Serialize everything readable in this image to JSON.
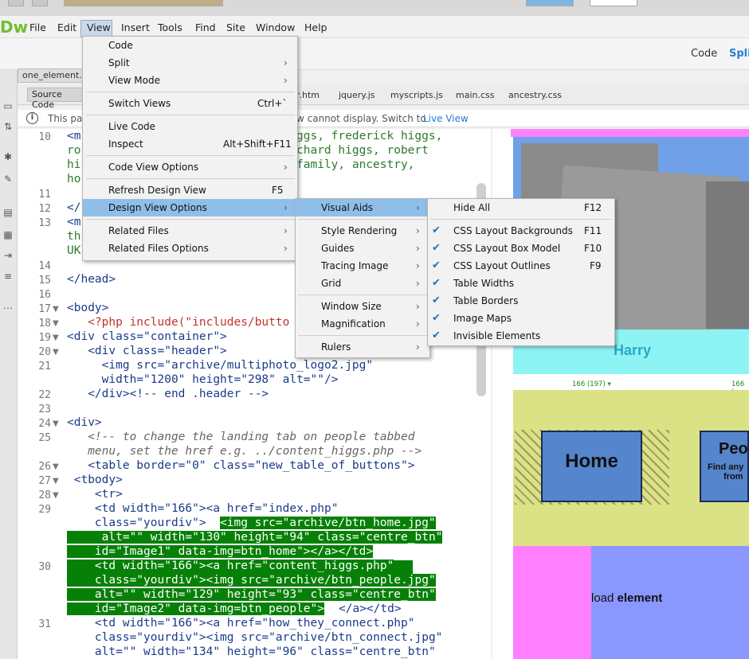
{
  "app": {
    "logo": "Dw"
  },
  "menubar": [
    "File",
    "Edit",
    "View",
    "Insert",
    "Tools",
    "Find",
    "Site",
    "Window",
    "Help"
  ],
  "viewmodes": {
    "code": "Code",
    "split": "Split"
  },
  "doc_tab": "one_element.h",
  "source_code_button": "Source Code",
  "file_tabs": [
    "r.htm",
    "jquery.js",
    "myscripts.js",
    "main.css",
    "ancestry.css"
  ],
  "infobar": {
    "pre": "This pag",
    "post": "w cannot display. Switch to",
    "link": "Live View",
    "end": "."
  },
  "view_menu": [
    {
      "label": "Code",
      "shortcut": "",
      "submenu": false
    },
    {
      "label": "Split",
      "shortcut": "",
      "submenu": true
    },
    {
      "label": "View Mode",
      "shortcut": "",
      "submenu": true
    },
    {
      "label": "Switch Views",
      "shortcut": "Ctrl+`",
      "submenu": false
    },
    {
      "label": "Live Code",
      "shortcut": "",
      "submenu": false
    },
    {
      "label": "Inspect",
      "shortcut": "Alt+Shift+F11",
      "submenu": false
    },
    {
      "label": "Code View Options",
      "shortcut": "",
      "submenu": true
    },
    {
      "label": "Refresh Design View",
      "shortcut": "F5",
      "submenu": false
    },
    {
      "label": "Design View Options",
      "shortcut": "",
      "submenu": true
    },
    {
      "label": "Related Files",
      "shortcut": "",
      "submenu": true
    },
    {
      "label": "Related Files Options",
      "shortcut": "",
      "submenu": true
    }
  ],
  "design_view_options_menu": [
    "Visual Aids",
    "Style Rendering",
    "Guides",
    "Tracing Image",
    "Grid",
    "Window Size",
    "Magnification",
    "Rulers"
  ],
  "visual_aids_menu": [
    {
      "label": "Hide All",
      "shortcut": "F12",
      "checked": false
    },
    {
      "label": "CSS Layout Backgrounds",
      "shortcut": "F11",
      "checked": true
    },
    {
      "label": "CSS Layout Box Model",
      "shortcut": "F10",
      "checked": true
    },
    {
      "label": "CSS Layout Outlines",
      "shortcut": "F9",
      "checked": true
    },
    {
      "label": "Table Widths",
      "shortcut": "",
      "checked": true
    },
    {
      "label": "Table Borders",
      "shortcut": "",
      "checked": true
    },
    {
      "label": "Image Maps",
      "shortcut": "",
      "checked": true
    },
    {
      "label": "Invisible Elements",
      "shortcut": "",
      "checked": true
    }
  ],
  "code_lines": {
    "l10a": "<m",
    "l10b": "ggs, frederick higgs,",
    "l10c": "ro",
    "l10d": "chard higgs, robert",
    "l10e": "hi",
    "l10f": "family, ancestry,",
    "l10g": "ho",
    "l12": "</",
    "l13a": "<m",
    "l13b": "th",
    "l13c": "UK",
    "l15": "</head>",
    "l17": "<body>",
    "l18": "   <?php include(\"includes/butto",
    "l19": "<div class=\"container\">",
    "l20": "   <div class=\"header\">",
    "l21a": "     <img src=\"archive/multiphoto_logo2.jpg\"",
    "l21b": "     width=\"1200\" height=\"298\" alt=\"\"/>",
    "l22": "   </div><!-- end .header -->",
    "l24": "<div>",
    "l25a": "   <!-- to change the landing tab on people tabbed",
    "l25b": "   menu, set the href e.g. ../content_higgs.php -->",
    "l26": "   <table border=\"0\" class=\"new_table_of_buttons\">",
    "l27": " <tbody>",
    "l28": "    <tr>",
    "l29a": "    <td width=\"166\"><a href=\"index.php\"",
    "l29b": "    class=\"yourdiv\">",
    "l29c": "<img src=\"archive/btn_home.jpg\"",
    "l29d": "     alt=\"\" width=\"130\" height=\"94\" class=\"centre_btn\"",
    "l29e": "    id=\"Image1\" data-img=btn_home\"></a></td>",
    "l30a": "    <td width=\"166\"><a href=\"content_higgs.php\"",
    "l30b": "    class=\"yourdiv\"><img src=\"archive/btn_people.jpg\"",
    "l30c": "    alt=\"\" width=\"129\" height=\"93\" class=\"centre_btn\"",
    "l30d": "    id=\"Image2\" data-img=btn_people\">",
    "l30e": "</a></td>",
    "l31a": "    <td width=\"166\"><a href=\"how_they_connect.php\"",
    "l31b": "    class=\"yourdiv\"><img src=\"archive/btn_connect.jpg\"",
    "l31c": "    alt=\"\" width=\"134\" height=\"96\" class=\"centre_btn\""
  },
  "line_numbers": [
    "10",
    "11",
    "12",
    "13",
    "14",
    "15",
    "16",
    "17",
    "18",
    "19",
    "20",
    "21",
    "22",
    "23",
    "24",
    "25",
    "26",
    "27",
    "28",
    "29",
    "30",
    "31"
  ],
  "design": {
    "harry": "Harry",
    "width_label_1": "166 (197) ▾",
    "width_label_2": "166 (",
    "home_button": "Home",
    "people_title": "Peo",
    "people_sub1": "Find any",
    "people_sub2": "from",
    "load_text_pre": "load ",
    "load_text_bold": "element"
  },
  "colors": {
    "accent": "#8fbfe8",
    "highlight": "#078007",
    "dw_green": "#6fbf2f",
    "link": "#2a7ad5"
  }
}
